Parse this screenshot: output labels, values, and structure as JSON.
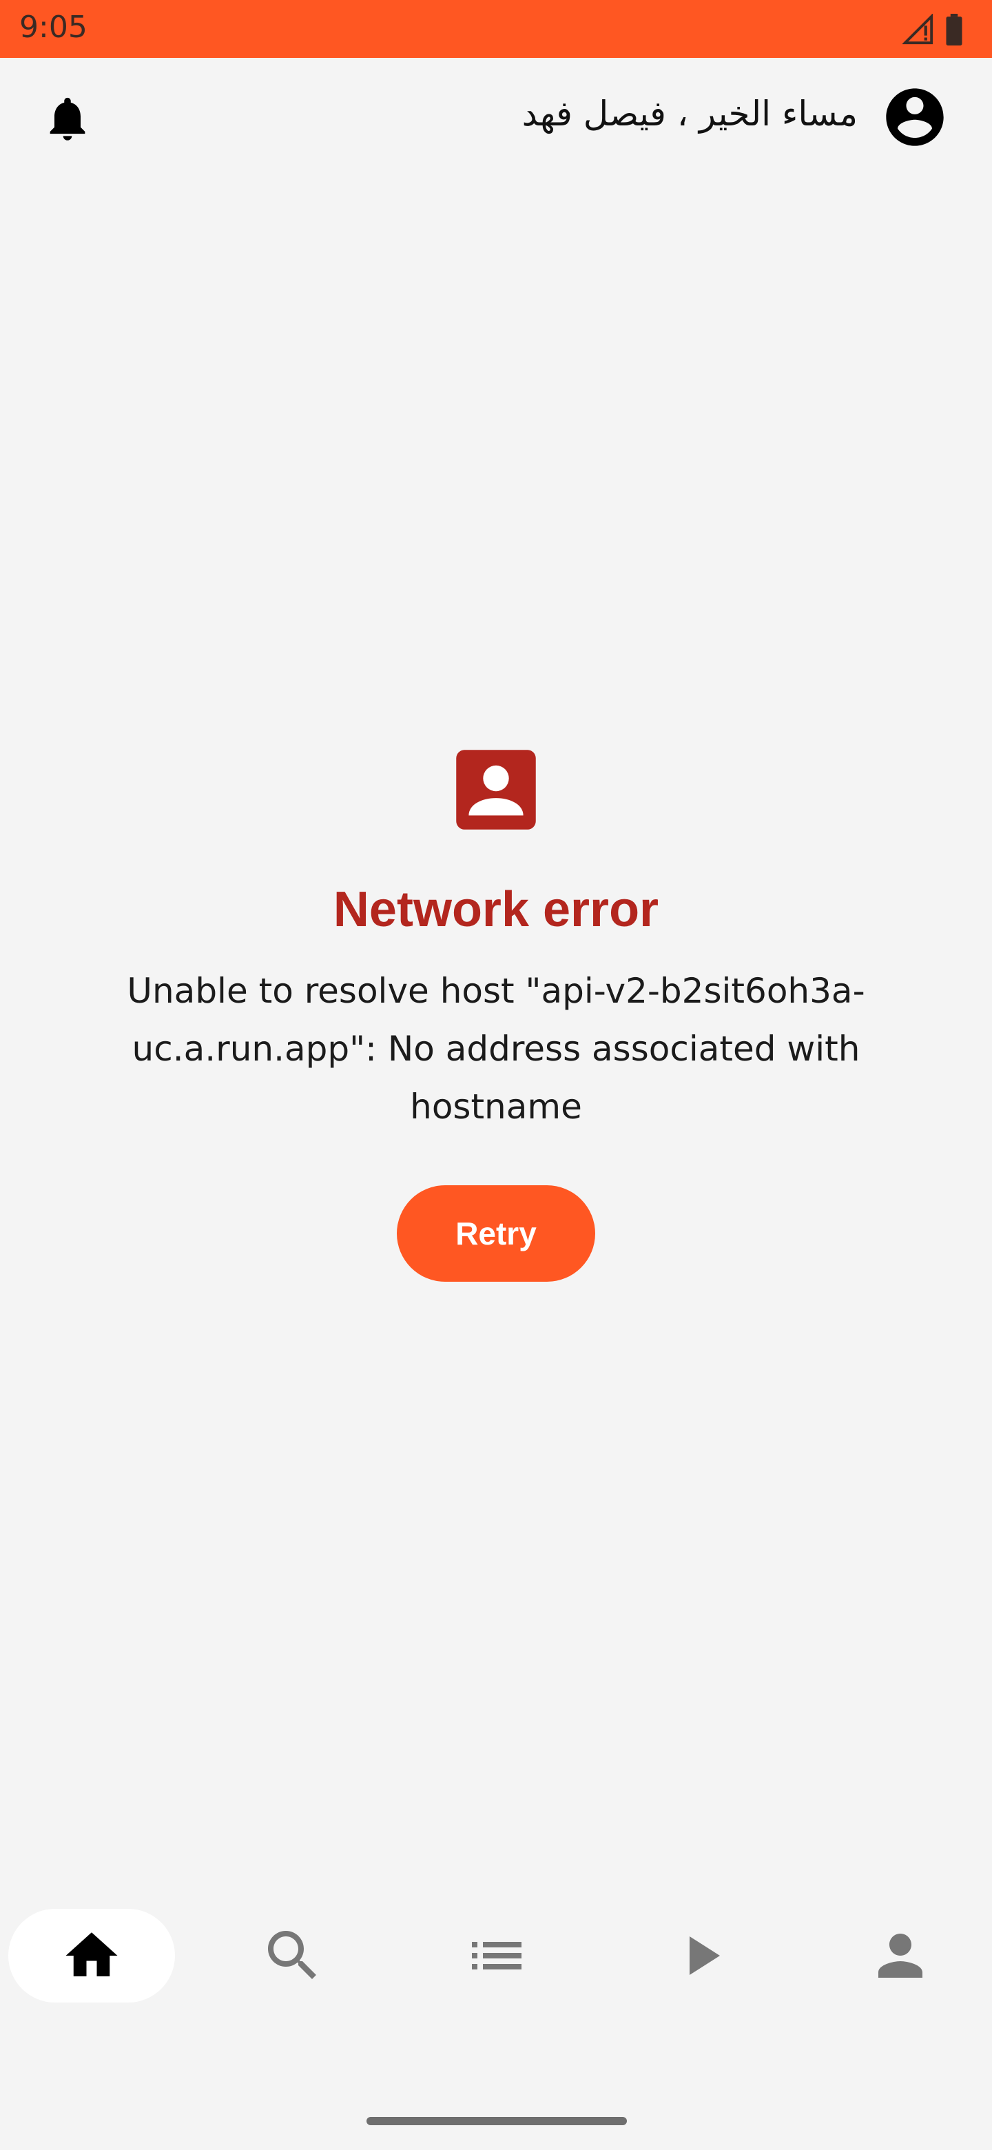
{
  "status_bar": {
    "time": "9:05",
    "color": "#ff5722",
    "icons": [
      "signal-alert-icon",
      "battery-icon"
    ]
  },
  "header": {
    "greeting": "مساء الخير ، فيصل فهد",
    "left_icon": "bell-icon",
    "right_icon": "account-circle-icon"
  },
  "error": {
    "icon": "contact-card-icon",
    "title": "Network error",
    "message": "Unable to resolve host \"api-v2-b2sit6oh3a-uc.a.run.app\": No address associated with hostname",
    "retry_label": "Retry",
    "title_color": "#b3261e",
    "accent": "#ff5722"
  },
  "bottom_nav": {
    "items": [
      {
        "name": "home",
        "icon": "home-icon",
        "active": true
      },
      {
        "name": "search",
        "icon": "search-icon",
        "active": false
      },
      {
        "name": "list",
        "icon": "list-icon",
        "active": false
      },
      {
        "name": "play",
        "icon": "play-icon",
        "active": false
      },
      {
        "name": "profile",
        "icon": "person-icon",
        "active": false
      }
    ]
  }
}
